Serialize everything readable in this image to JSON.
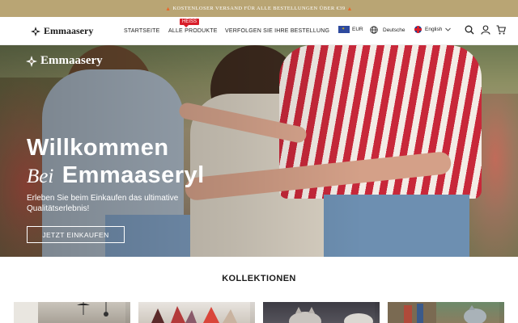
{
  "announcement": {
    "text": "KOSTENLOSER VERSAND FÜR ALLE BESTELLUNGEN ÜBER €39",
    "icon": "fire-icon"
  },
  "header": {
    "logo": "Emmaasery",
    "nav": [
      {
        "label": "STARTSEITE"
      },
      {
        "label": "ALLE PRODUKTE",
        "badge": "HEISS"
      },
      {
        "label": "VERFOLGEN SIE IHRE BESTELLUNG"
      }
    ],
    "currency": "EUR",
    "language_region": "Deutsche",
    "language": "English",
    "icons": [
      "search-icon",
      "user-icon",
      "cart-icon"
    ]
  },
  "hero": {
    "logo": "Emmaasery",
    "title_line1": "Willkommen",
    "title_bei": "Bei",
    "title_brand": "Emmaaseryl",
    "subtitle": "Erleben Sie beim Einkaufen das ultimative Qualitätserlebnis!",
    "cta": "JETZT EINKAUFEN"
  },
  "collections": {
    "title": "KOLLEKTIONEN"
  },
  "colors": {
    "announcement_bg": "#b9a574",
    "badge": "#d81e2a",
    "text": "#222222"
  }
}
